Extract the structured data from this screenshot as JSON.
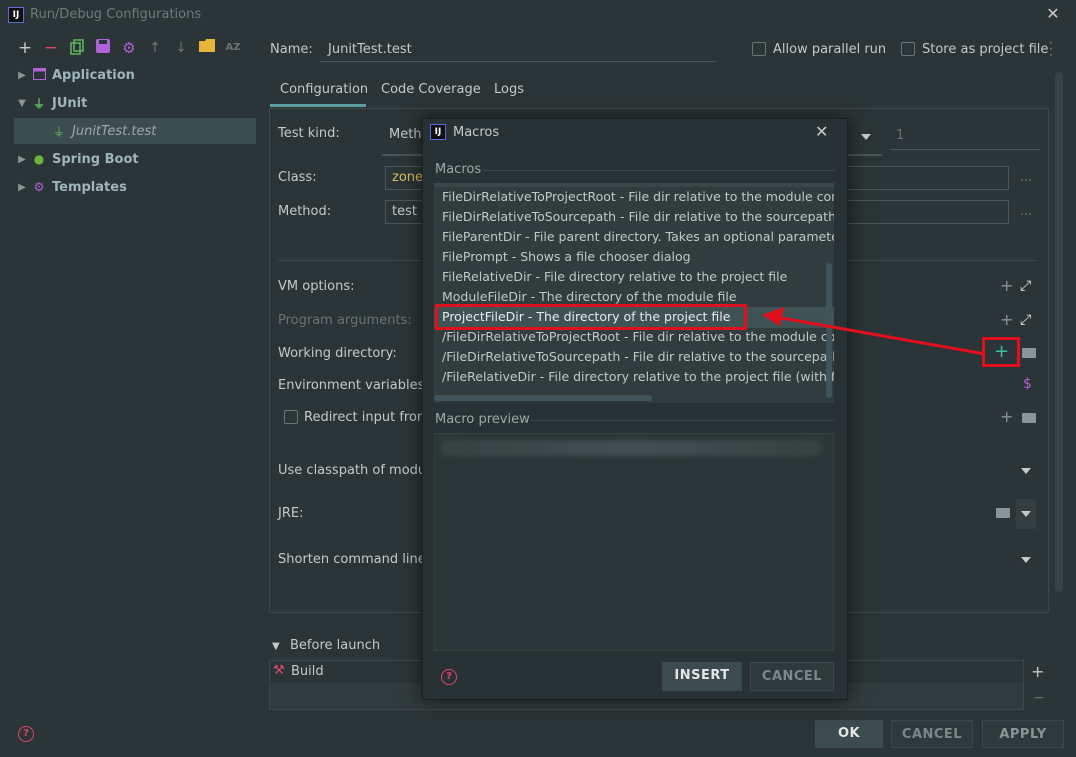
{
  "window": {
    "title": "Run/Debug Configurations",
    "logo": "IJ"
  },
  "toolbar": {
    "icons": [
      "plus-icon",
      "minus-icon",
      "copy-icon",
      "save-icon",
      "gear-icon",
      "arrow-up-icon",
      "arrow-down-icon",
      "folder-icon",
      "sort-az-icon"
    ],
    "az": "AZ"
  },
  "tree": {
    "items": [
      {
        "label": "Application"
      },
      {
        "label": "JUnit"
      },
      {
        "label": "JunitTest.test"
      },
      {
        "label": "Spring Boot"
      },
      {
        "label": "Templates"
      }
    ]
  },
  "header": {
    "name_label": "Name:",
    "name_value": "JunitTest.test",
    "allow_parallel": "Allow parallel run",
    "store_as_project": "Store as project file"
  },
  "tabs": [
    {
      "label": "Configuration"
    },
    {
      "label": "Code Coverage"
    },
    {
      "label": "Logs"
    }
  ],
  "config": {
    "test_kind_label": "Test kind:",
    "test_kind_value": "Metho",
    "repeat_value": "1",
    "class_label": "Class:",
    "class_value": "zonet",
    "method_label": "Method:",
    "method_value": "test",
    "vm_options": "VM options:",
    "program_arguments": "Program arguments:",
    "working_directory": "Working directory:",
    "env_variables": "Environment variables:",
    "redirect_input": "Redirect input from:",
    "use_classpath": "Use classpath of module",
    "jre": "JRE:",
    "shorten_cmd": "Shorten command line:",
    "dollar": "$",
    "ellipsis": "..."
  },
  "before_launch": {
    "label": "Before launch",
    "build": "Build"
  },
  "footer": {
    "ok": "OK",
    "cancel": "CANCEL",
    "apply": "APPLY"
  },
  "macros_dialog": {
    "title": "Macros",
    "logo": "IJ",
    "macros_label": "Macros",
    "items": [
      "FileDirRelativeToProjectRoot - File dir relative to the module conten",
      "FileDirRelativeToSourcepath - File dir relative to the sourcepath roo",
      "FileParentDir - File parent directory. Takes an optional parameter(n",
      "FilePrompt - Shows a file chooser dialog",
      "FileRelativeDir - File directory relative to the project file",
      "ModuleFileDir - The directory of the module file",
      "ProjectFileDir - The directory of the project file",
      "/FileDirRelativeToProjectRoot - File dir relative to the module conte",
      "/FileDirRelativeToSourcepath - File dir relative to the sourcepath roo",
      "/FileRelativeDir - File directory relative to the project file (with forwa"
    ],
    "selected_index": 6,
    "preview_label": "Macro preview",
    "insert": "INSERT",
    "cancel": "CANCEL"
  },
  "colors": {
    "accent": "#5f9ea0",
    "highlight_box": "#e0101f",
    "help": "#e0456a"
  }
}
